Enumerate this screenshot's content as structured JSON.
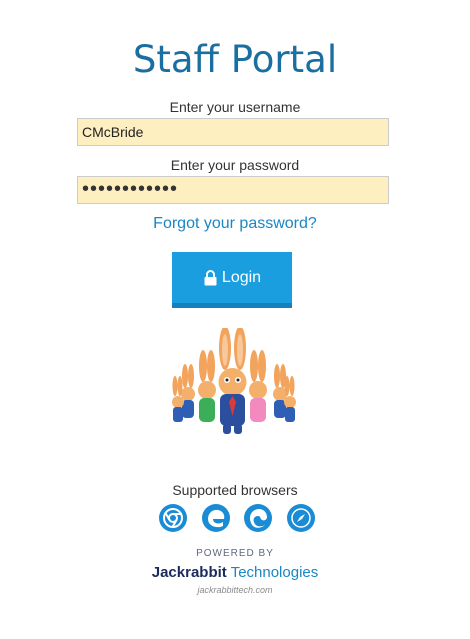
{
  "page": {
    "title": "Staff Portal"
  },
  "form": {
    "username_label": "Enter your username",
    "username_value": "CMcBride",
    "password_label": "Enter your password",
    "password_value": "••••••••••••",
    "forgot_link": "Forgot your password?",
    "login_label": "Login"
  },
  "footer": {
    "browsers_label": "Supported browsers",
    "browsers": [
      "chrome-icon",
      "edge-legacy-icon",
      "edge-icon",
      "safari-icon"
    ],
    "powered_by": "POWERED BY",
    "brand_name": "Jackrabbit",
    "brand_suffix": "Technologies",
    "site": "jackrabbittech.com"
  },
  "colors": {
    "title": "#1a6fa0",
    "input_fill": "#fdefc0",
    "link": "#1a86c4",
    "button": "#1a9ee0",
    "brand_dark": "#1c2b5e"
  }
}
